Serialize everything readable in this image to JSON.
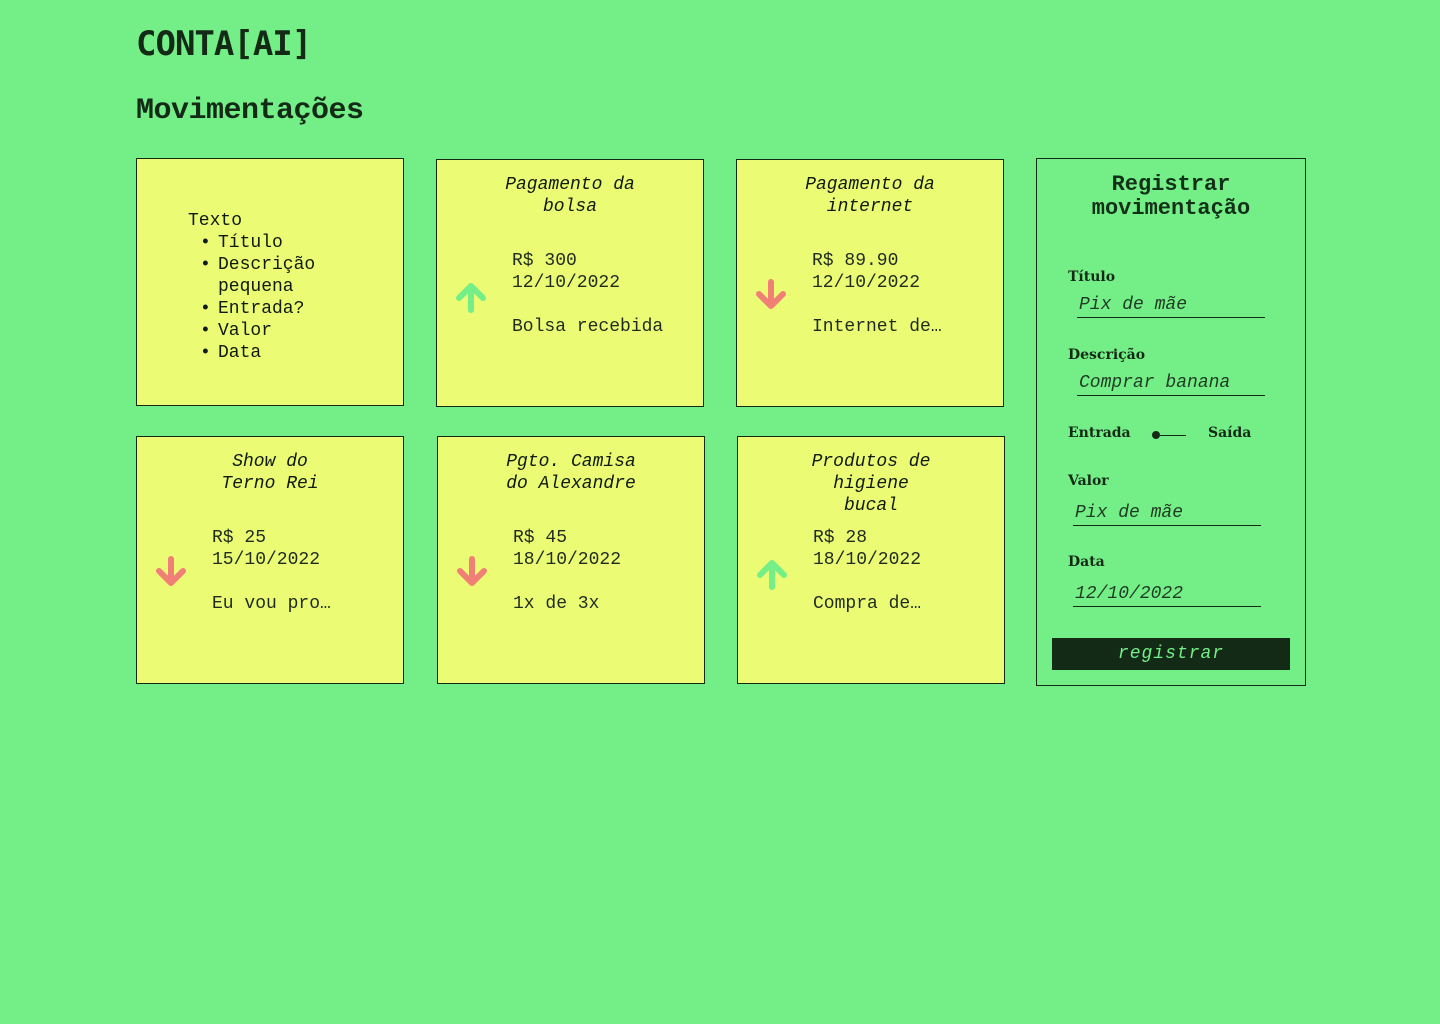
{
  "header": {
    "brand": "CONTA[AI]",
    "section_title": "Movimentações"
  },
  "legend_card": {
    "heading": "Texto",
    "items": [
      "Título",
      "Descrição pequena",
      "Entrada?",
      "Valor",
      "Data"
    ]
  },
  "cards": [
    {
      "title": "Pagamento da\nbolsa",
      "value": "R$ 300",
      "date": "12/10/2022",
      "description": "Bolsa recebida",
      "direction": "up",
      "icon": "arrow-up-icon"
    },
    {
      "title": "Pagamento da\ninternet",
      "value": "R$ 89.90",
      "date": "12/10/2022",
      "description": "Internet de…",
      "direction": "down",
      "icon": "arrow-down-icon"
    },
    {
      "title": "Show do\nTerno Rei",
      "value": "R$ 25",
      "date": "15/10/2022",
      "description": "Eu vou pro…",
      "direction": "down",
      "icon": "arrow-down-icon"
    },
    {
      "title": "Pgto. Camisa\ndo Alexandre",
      "value": "R$ 45",
      "date": "18/10/2022",
      "description": "1x de 3x",
      "direction": "down",
      "icon": "arrow-down-icon"
    },
    {
      "title": "Produtos de\nhigiene\nbucal",
      "value": "R$ 28",
      "date": "18/10/2022",
      "description": "Compra de…",
      "direction": "up",
      "icon": "arrow-up-icon"
    }
  ],
  "form": {
    "title": "Registrar\nmovimentação",
    "titulo_label": "Título",
    "titulo_placeholder": "Pix de mãe",
    "descricao_label": "Descrição",
    "descricao_placeholder": "Comprar banana",
    "toggle_left_label": "Entrada",
    "toggle_right_label": "Saída",
    "valor_label": "Valor",
    "valor_placeholder": "Pix de mãe",
    "data_label": "Data",
    "data_placeholder": "12/10/2022",
    "submit_label": "registrar"
  },
  "colors": {
    "background": "#74ee86",
    "card": "#ecfb74",
    "dark": "#132a17",
    "arrow_up": "#74ee86",
    "arrow_down": "#f07f76"
  }
}
